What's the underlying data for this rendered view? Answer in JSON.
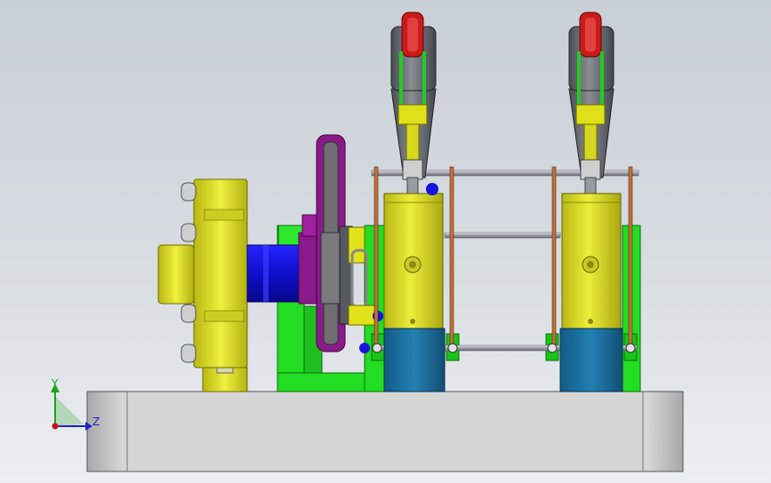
{
  "triad": {
    "y_label": "Y",
    "z_label": "Z",
    "y_color": "#1aa31a",
    "z_color": "#2020cc",
    "x_color": "#d01010"
  },
  "colors": {
    "background_top": "#c9cfd6",
    "background_bottom": "#eceff2",
    "base_plate": "#d5d5d5",
    "frame_green": "#22dd22",
    "cylinder_yellow": "#d8d820",
    "cylinder_blue": "#1e6fa0",
    "hub_blue": "#1515dd",
    "crank_red": "#cc1a1a",
    "head_gray": "#6a6e74",
    "rod_copper": "#b8652a",
    "flywheel_purple": "#8a1a8a",
    "flange_yellow": "#e6e61a"
  }
}
